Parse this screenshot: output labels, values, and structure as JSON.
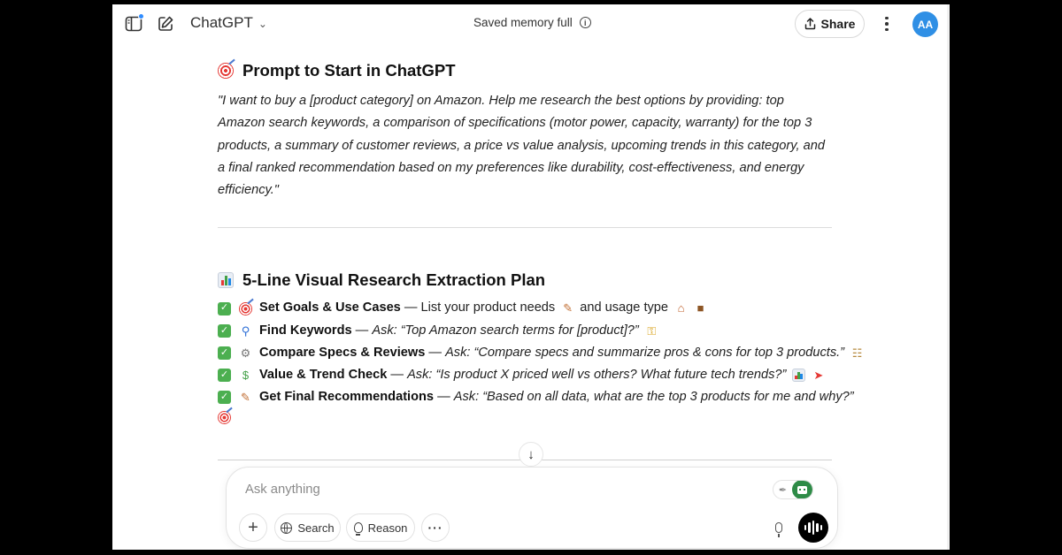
{
  "header": {
    "model_label": "ChatGPT",
    "memory_status": "Saved memory full",
    "share_label": "Share",
    "avatar_initials": "AA",
    "accent_color": "#2f8fe5"
  },
  "section_prompt": {
    "heading": "Prompt to Start in ChatGPT",
    "heading_icon": "target-icon",
    "text": "\"I want to buy a [product category] on Amazon. Help me research the best options by providing: top Amazon search keywords, a comparison of specifications (motor power, capacity, warranty) for the top 3 products, a summary of customer reviews, a price vs value analysis, upcoming trends in this category, and a final ranked recommendation based on my preferences like durability, cost-effectiveness, and energy efficiency.\""
  },
  "section_plan": {
    "heading": "5-Line Visual Research Extraction Plan",
    "heading_icon": "bar-chart-icon",
    "items": [
      {
        "icon": "target-icon",
        "title": "Set Goals & Use Cases",
        "sep": " — ",
        "plain": "List your product needs",
        "italic": "",
        "suffix": "and usage type"
      },
      {
        "icon": "magnifier-icon",
        "title": "Find Keywords",
        "sep": " — ",
        "plain": "",
        "italic": "Ask: “Top Amazon search terms for [product]?”",
        "suffix": ""
      },
      {
        "icon": "gear-icon",
        "title": "Compare Specs & Reviews",
        "sep": " — ",
        "plain": "",
        "italic": "Ask: “Compare specs and summarize pros & cons for top 3 products.”",
        "suffix": ""
      },
      {
        "icon": "money-icon",
        "title": "Value & Trend Check",
        "sep": " — ",
        "plain": "",
        "italic": "Ask: “Is product X priced well vs others? What future tech trends?”",
        "suffix": ""
      },
      {
        "icon": "memo-icon",
        "title": "Get Final Recommendations",
        "sep": " — ",
        "plain": "",
        "italic": "Ask: “Based on all data, what are the top 3 products for me and why?”",
        "suffix": ""
      }
    ],
    "check_color": "#4caf50"
  },
  "composer": {
    "placeholder": "Ask anything",
    "search_label": "Search",
    "reason_label": "Reason",
    "toggle_color": "#2e8b47"
  }
}
